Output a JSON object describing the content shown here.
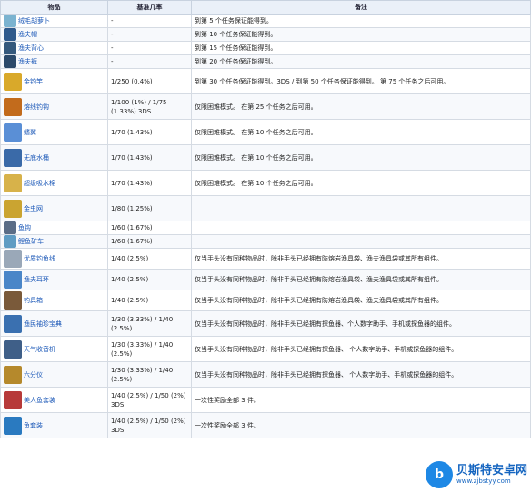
{
  "headers": {
    "item": "物品",
    "rate": "基准几率",
    "note": "备注"
  },
  "rows": [
    {
      "item": "绒毛胡萝卜",
      "rate": "-",
      "note": "到第 5 个任务保证能得到。",
      "icon_color": "#7bb3d0",
      "plat": true
    },
    {
      "item": "渔夫帽",
      "rate": "-",
      "note": "到第 10 个任务保证能得到。",
      "icon_color": "#2f5a8c"
    },
    {
      "item": "渔夫背心",
      "rate": "-",
      "note": "到第 15 个任务保证能得到。",
      "icon_color": "#35597c"
    },
    {
      "item": "渔夫裤",
      "rate": "-",
      "note": "到第 20 个任务保证能得到。",
      "icon_color": "#2c4a6a"
    },
    {
      "item": "金钓竿",
      "rate": "1/250 (0.4%)",
      "note": "到第 30 个任务保证能得到。3DS / 到第 50 个任务保证能得到。 第 75 个任务之后可用。",
      "icon_color": "#d9a92a"
    },
    {
      "item": "熔线钓钩",
      "rate": "1/100 (1%) / 1/75 (1.33%) 3DS",
      "note": "仅限困难模式。 在第 25 个任务之后可用。",
      "icon_color": "#c26b1c"
    },
    {
      "item": "鳍翼",
      "rate": "1/70 (1.43%)",
      "note": "仅限困难模式。 在第 10 个任务之后可用。",
      "icon_color": "#5a8fd6"
    },
    {
      "item": "无底水桶",
      "rate": "1/70 (1.43%)",
      "note": "仅限困难模式。 在第 10 个任务之后可用。",
      "icon_color": "#3a6aa8"
    },
    {
      "item": "超级吸水棉",
      "rate": "1/70 (1.43%)",
      "note": "仅限困难模式。 在第 10 个任务之后可用。",
      "icon_color": "#d7b24a"
    },
    {
      "item": "金虫网",
      "rate": "1/80 (1.25%)",
      "note": "",
      "icon_color": "#caa431"
    },
    {
      "item": "鱼钩",
      "rate": "1/60 (1.67%)",
      "note": "",
      "icon_color": "#5b6d86"
    },
    {
      "item": "鲤鱼矿车",
      "rate": "1/60 (1.67%)",
      "note": "",
      "icon_color": "#5f9cc3"
    },
    {
      "item": "优质钓鱼线",
      "rate": "1/40 (2.5%)",
      "note": "仅当手头没有同种物品时，除非手头已经拥有防熔岩渔具袋、渔夫渔具袋或其所有组件。",
      "icon_color": "#9aa8b8"
    },
    {
      "item": "渔夫耳环",
      "rate": "1/40 (2.5%)",
      "note": "仅当手头没有同种物品时，除非手头已经拥有防熔岩渔具袋、渔夫渔具袋或其所有组件。",
      "icon_color": "#4a86c8"
    },
    {
      "item": "钓具箱",
      "rate": "1/40 (2.5%)",
      "note": "仅当手头没有同种物品时，除非手头已经拥有防熔岩渔具袋、渔夫渔具袋或其所有组件。",
      "icon_color": "#7a5a3a"
    },
    {
      "item": "渔民袖珍宝典",
      "rate": "1/30 (3.33%) / 1/40 (2.5%)",
      "note": "仅当手头没有同种物品时，除非手头已经拥有探鱼器、个人数字助手、手机或探鱼器的组件。",
      "icon_color": "#3a70b0"
    },
    {
      "item": "天气收音机",
      "rate": "1/30 (3.33%) / 1/40 (2.5%)",
      "note": "仅当手头没有同种物品时，除非手头已经拥有探鱼器、 个人数字助手、手机或探鱼器的组件。",
      "icon_color": "#3f5f88"
    },
    {
      "item": "六分仪",
      "rate": "1/30 (3.33%) / 1/40 (2.5%)",
      "note": "仅当手头没有同种物品时，除非手头已经拥有探鱼器、 个人数字助手、手机或探鱼器的组件。",
      "icon_color": "#b5892c"
    },
    {
      "item": "美人鱼套装",
      "rate": "1/40 (2.5%) / 1/50 (2%) 3DS",
      "note": "一次性奖励全部 3 件。",
      "icon_color": "#b73a3a"
    },
    {
      "item": "鱼套装",
      "rate": "1/40 (2.5%) / 1/50 (2%) 3DS",
      "note": "一次性奖励全部 3 件。",
      "icon_color": "#2a7ac0"
    }
  ],
  "watermark": {
    "title": "贝斯特安卓网",
    "url": "www.zjbstyy.com"
  }
}
